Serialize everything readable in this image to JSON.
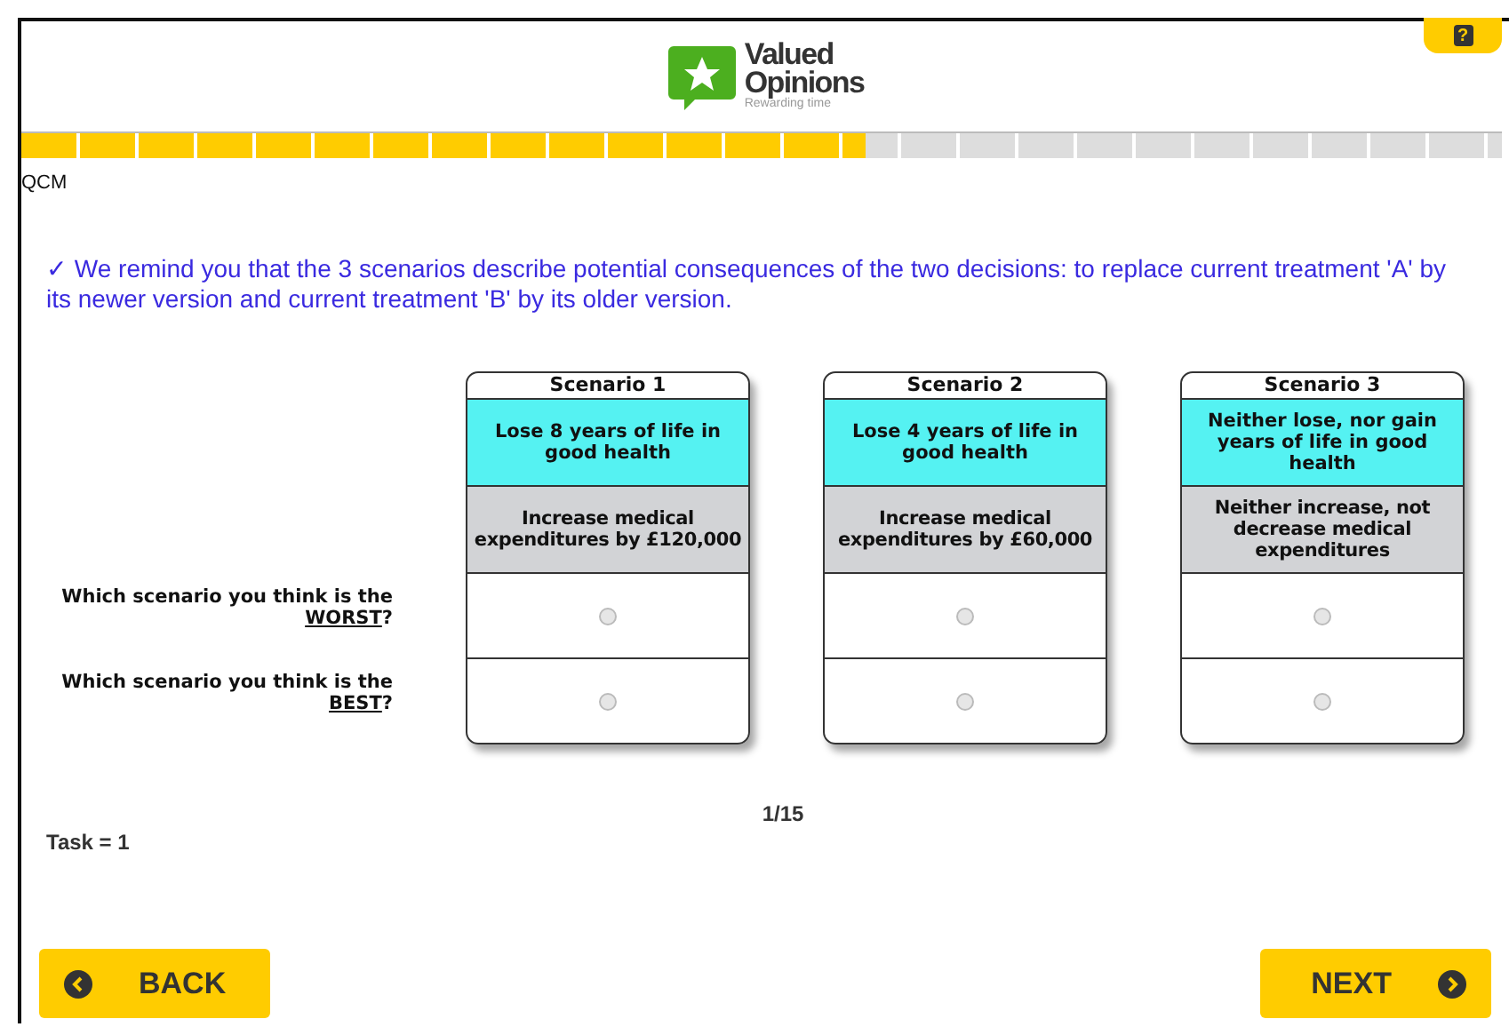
{
  "header": {
    "logo": {
      "name": "Valued",
      "name_2": "Opinions",
      "tagline": "Rewarding time"
    },
    "help": "?"
  },
  "progress": {
    "level": 0.57
  },
  "section_label": "QCM",
  "reminder": "✓ We remind you that the 3 scenarios describe potential consequences of the two decisions: to replace current treatment 'A' by its newer version and current treatment 'B' by its older version.",
  "questions": [
    {
      "text": "Which scenario you think is the ",
      "emphasis": "WORST",
      "suffix": "?"
    },
    {
      "text": "Which scenario you think is the ",
      "emphasis": "BEST",
      "suffix": "?"
    }
  ],
  "scenarios": [
    {
      "title": "Scenario 1",
      "health": "Lose 8 years of life in good health",
      "cost": "Increase medical expenditures by £120,000",
      "answers": [
        {
          "selected": false
        },
        {
          "selected": false
        }
      ]
    },
    {
      "title": "Scenario 2",
      "health": "Lose 4 years of life in good health",
      "cost": "Increase medical expenditures by £60,000",
      "answers": [
        {
          "selected": false
        },
        {
          "selected": false
        }
      ]
    },
    {
      "title": "Scenario 3",
      "health": "Neither lose, nor gain years of life in good health",
      "cost": "Neither increase, not decrease medical expenditures",
      "answers": [
        {
          "selected": false
        },
        {
          "selected": false
        }
      ]
    }
  ],
  "page_counter": "1/15",
  "task": "Task = 1",
  "buttons": {
    "back": "BACK",
    "next": "NEXT"
  }
}
